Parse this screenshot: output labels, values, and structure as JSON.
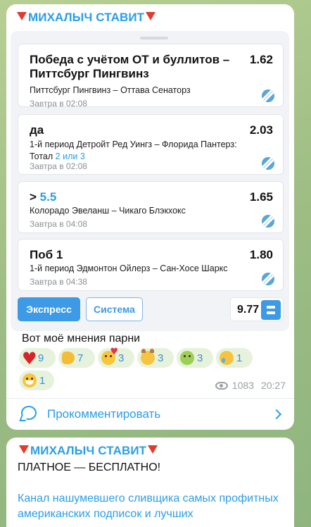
{
  "message1": {
    "channel_name": "МИХАЛЫЧ СТАВИТ",
    "bets": [
      {
        "title": "Победа с учётом ОТ и буллитов – Питтсбург Пингвинз",
        "title_highlight": "",
        "odds": "1.62",
        "event": "Питтсбург Пингвинз – Оттава Сенаторз",
        "event_suffix": "",
        "time": "Завтра в 02:08"
      },
      {
        "title": "да",
        "title_highlight": "",
        "odds": "2.03",
        "event": "1-й период Детройт Ред Уингз – Флорида Пантерз: Тотал",
        "event_suffix": "2 или 3",
        "time": "Завтра в 02:08"
      },
      {
        "title": ">",
        "title_highlight": "5.5",
        "odds": "1.65",
        "event": "Колорадо Эвеланш – Чикаго Блэкхокс",
        "event_suffix": "",
        "time": "Завтра в 04:08"
      },
      {
        "title": "Поб 1",
        "title_highlight": "",
        "odds": "1.80",
        "event": "1-й период Эдмонтон Ойлерз – Сан-Хосе Шаркс",
        "event_suffix": "",
        "time": "Завтра в 04:38"
      }
    ],
    "express_label": "Экспресс",
    "system_label": "Система",
    "total_odds": "9.77",
    "text": "Вот моё мнения парни",
    "reactions": [
      {
        "icon": "heart-icon",
        "count": "9"
      },
      {
        "icon": "thumbs-up-icon",
        "count": "7"
      },
      {
        "icon": "smiling-face-with-hearts-icon",
        "count": "3"
      },
      {
        "icon": "devil-face-icon",
        "count": "3"
      },
      {
        "icon": "nauseated-face-icon",
        "count": "3"
      },
      {
        "icon": "crying-face-icon",
        "count": "1"
      },
      {
        "icon": "grinning-face-icon",
        "count": "1"
      }
    ],
    "views": "1083",
    "time": "20:27",
    "comment_label": "Прокомментировать"
  },
  "message2": {
    "channel_name": "МИХАЛЫЧ СТАВИТ",
    "headline": "ПЛАТНОЕ — БЕСПЛАТНО!",
    "body": "Канал нашумевшего сливщика самых профитных американских подписок и лучших"
  },
  "colors": {
    "accent": "#2a9ee6",
    "bubble": "#ffffff",
    "reaction_bg": "#e7f2dc",
    "flag_red": "#e23b2e"
  }
}
